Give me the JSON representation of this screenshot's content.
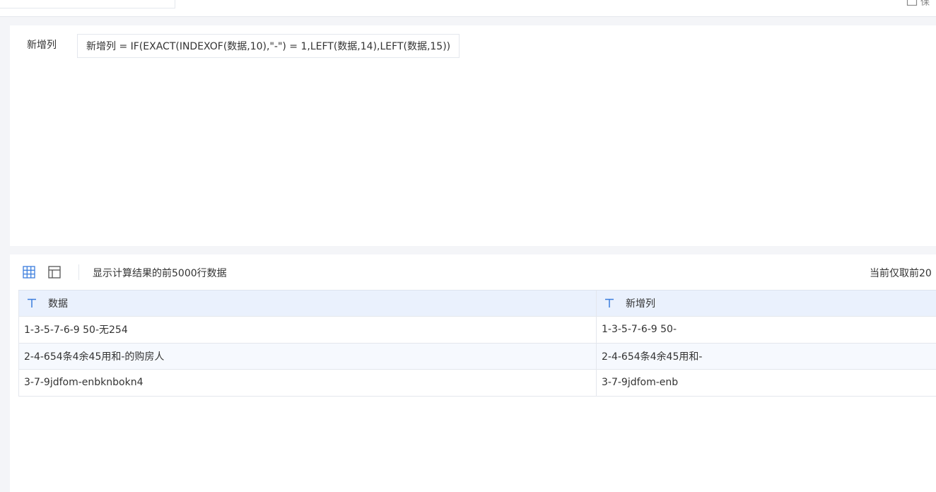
{
  "topbar": {
    "save_label": "保"
  },
  "formula": {
    "label": "新增列",
    "expression": "新增列 = IF(EXACT(INDEXOF(数据,10),\"-\") = 1,LEFT(数据,14),LEFT(数据,15))"
  },
  "toolbar": {
    "info": "显示计算结果的前5000行数据",
    "right_note": "当前仅取前20"
  },
  "table": {
    "columns": [
      {
        "name": "数据",
        "type_icon": "text-type-icon"
      },
      {
        "name": "新增列",
        "type_icon": "text-type-icon"
      }
    ],
    "rows": [
      [
        "1-3-5-7-6-9 50-无254",
        "1-3-5-7-6-9 50-"
      ],
      [
        "2-4-654条4余45用和-的购房人",
        "2-4-654条4余45用和-"
      ],
      [
        "3-7-9jdfom-enbknbokn4",
        "3-7-9jdfom-enb"
      ]
    ]
  },
  "colors": {
    "accent": "#3b7ddd",
    "header_bg": "#eaf1fd",
    "alt_row_bg": "#f6f9fe",
    "page_bg": "#f4f5f8"
  }
}
